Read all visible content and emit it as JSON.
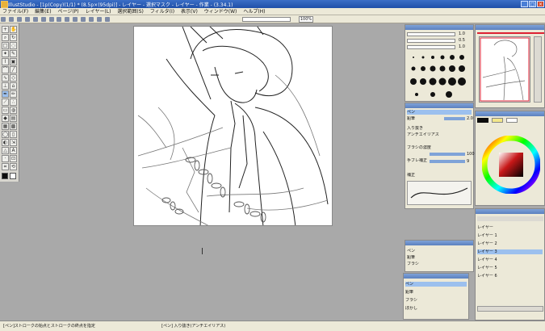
{
  "window": {
    "title": "IllustStudio - [1p(Copy)(1/1) * (8.5p×(95dpi)] - レイヤー - 選択マスク - レイヤー - 作業 - (3.34.1)"
  },
  "menu": [
    "ファイル(F)",
    "編集(E)",
    "ページ(P)",
    "レイヤー(L)",
    "選択範囲(S)",
    "フィルタ(I)",
    "表示(V)",
    "ウィンドウ(W)",
    "ヘルプ(H)"
  ],
  "toolbar": {
    "zoom": "100%"
  },
  "panels": {
    "brush_size": {
      "values": [
        "1.0",
        "0.5",
        "1.0"
      ]
    },
    "tool_options": {
      "items": [
        "ペン",
        "鉛筆",
        "入り抜き",
        "アンチエイリアス",
        "ブラシの濃度",
        "手ブレ補正",
        "補正"
      ],
      "values": [
        "2.0",
        "100",
        "9"
      ]
    },
    "layers": {
      "items": [
        "レイヤー",
        "レイヤー 1",
        "レイヤー 2",
        "レイヤー 3",
        "レイヤー 4",
        "レイヤー 5",
        "レイヤー 6"
      ]
    },
    "small_list": {
      "items": [
        "ペン",
        "鉛筆",
        "ブラシ",
        "ぼかし"
      ]
    }
  },
  "status": {
    "left": "[ペン]ストロークの始点とストロークの終点を指定",
    "right": "[ペン] 入り抜き(アンチエイリアス)"
  },
  "colors": {
    "accent": "#2a5bb0",
    "main": "#0c0c0c",
    "sub": "#f3e78a"
  }
}
